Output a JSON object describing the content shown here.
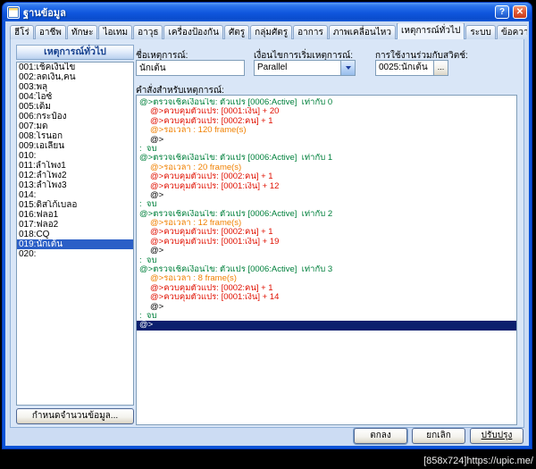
{
  "window": {
    "title": "ฐานข้อมูล",
    "controls": {
      "help": "?",
      "close": "✕"
    }
  },
  "tabs": [
    {
      "label": "ฮีโร่",
      "selected": false
    },
    {
      "label": "อาชีพ",
      "selected": false
    },
    {
      "label": "ทักษะ",
      "selected": false
    },
    {
      "label": "ไอเทม",
      "selected": false
    },
    {
      "label": "อาวุธ",
      "selected": false
    },
    {
      "label": "เครื่องป้องกัน",
      "selected": false
    },
    {
      "label": "ศัตรู",
      "selected": false
    },
    {
      "label": "กลุ่มศัตรู",
      "selected": false
    },
    {
      "label": "อาการ",
      "selected": false
    },
    {
      "label": "ภาพเคลื่อนไหว",
      "selected": false
    },
    {
      "label": "เหตุการณ์ทั่วไป",
      "selected": true
    },
    {
      "label": "ระบบ",
      "selected": false
    },
    {
      "label": "ข้อความ",
      "selected": false
    }
  ],
  "left_panel": {
    "header": "เหตุการณ์ทั่วไป",
    "items": [
      {
        "label": "001:เช็คเงินไข",
        "selected": false
      },
      {
        "label": "002:ลดเงิน,คน",
        "selected": false
      },
      {
        "label": "003:พลุ",
        "selected": false
      },
      {
        "label": "004:ไอซ์",
        "selected": false
      },
      {
        "label": "005:เด็ม",
        "selected": false
      },
      {
        "label": "006:กระป๋อง",
        "selected": false
      },
      {
        "label": "007:มด",
        "selected": false
      },
      {
        "label": "008:โรนอก",
        "selected": false
      },
      {
        "label": "009:เอเลี่ยน",
        "selected": false
      },
      {
        "label": "010:",
        "selected": false
      },
      {
        "label": "011:ลำโพง1",
        "selected": false
      },
      {
        "label": "012:ลำโพง2",
        "selected": false
      },
      {
        "label": "013:ลำโพง3",
        "selected": false
      },
      {
        "label": "014:",
        "selected": false
      },
      {
        "label": "015:ดิสโก้เบลอ",
        "selected": false
      },
      {
        "label": "016:ฟลอ1",
        "selected": false
      },
      {
        "label": "017:ฟลอ2",
        "selected": false
      },
      {
        "label": "018:CQ",
        "selected": false
      },
      {
        "label": "019:นักเต้น",
        "selected": true
      },
      {
        "label": "020:",
        "selected": false
      }
    ],
    "set_amount_button": "กำหนดจำนวนข้อมูล..."
  },
  "right_panel": {
    "name_label": "ชื่อเหตุการณ์:",
    "name_value": "นักเต้น",
    "trigger_label": "เงื่อนไขการเริ่มเหตุการณ์:",
    "trigger_value": "Parallel",
    "switch_label": "การใช้งานร่วมกับสวิตช์:",
    "switch_value": "0025:นักเต้น",
    "switch_browse": "...",
    "commands_label": "คำสั่งสำหรับเหตุการณ์:",
    "commands": [
      {
        "text": "@>ตรวจเช็คเงื่อนไข: ตัวแปร [0006:Active]  เท่ากับ 0",
        "color": "#00803c",
        "indent": 0
      },
      {
        "text": "@>ควบคุมตัวแปร: [0001:เงิน] + 20",
        "color": "#e01000",
        "indent": 1
      },
      {
        "text": "@>ควบคุมตัวแปร: [0002:คน] + 1",
        "color": "#e01000",
        "indent": 1
      },
      {
        "text": "@>รอเวลา : 120 frame(s)",
        "color": "#f08000",
        "indent": 1
      },
      {
        "text": "@>",
        "color": "#000000",
        "indent": 1
      },
      {
        "text": ":  จบ",
        "color": "#00803c",
        "indent": 0
      },
      {
        "text": "@>ตรวจเช็คเงื่อนไข: ตัวแปร [0006:Active]  เท่ากับ 1",
        "color": "#00803c",
        "indent": 0
      },
      {
        "text": "@>รอเวลา : 20 frame(s)",
        "color": "#f08000",
        "indent": 1
      },
      {
        "text": "@>ควบคุมตัวแปร: [0002:คน] + 1",
        "color": "#e01000",
        "indent": 1
      },
      {
        "text": "@>ควบคุมตัวแปร: [0001:เงิน] + 12",
        "color": "#e01000",
        "indent": 1
      },
      {
        "text": "@>",
        "color": "#000000",
        "indent": 1
      },
      {
        "text": ":  จบ",
        "color": "#00803c",
        "indent": 0
      },
      {
        "text": "@>ตรวจเช็คเงื่อนไข: ตัวแปร [0006:Active]  เท่ากับ 2",
        "color": "#00803c",
        "indent": 0
      },
      {
        "text": "@>รอเวลา : 12 frame(s)",
        "color": "#f08000",
        "indent": 1
      },
      {
        "text": "@>ควบคุมตัวแปร: [0002:คน] + 1",
        "color": "#e01000",
        "indent": 1
      },
      {
        "text": "@>ควบคุมตัวแปร: [0001:เงิน] + 19",
        "color": "#e01000",
        "indent": 1
      },
      {
        "text": "@>",
        "color": "#000000",
        "indent": 1
      },
      {
        "text": ":  จบ",
        "color": "#00803c",
        "indent": 0
      },
      {
        "text": "@>ตรวจเช็คเงื่อนไข: ตัวแปร [0006:Active]  เท่ากับ 3",
        "color": "#00803c",
        "indent": 0
      },
      {
        "text": "@>รอเวลา : 8 frame(s)",
        "color": "#f08000",
        "indent": 1
      },
      {
        "text": "@>ควบคุมตัวแปร: [0002:คน] + 1",
        "color": "#e01000",
        "indent": 1
      },
      {
        "text": "@>ควบคุมตัวแปร: [0001:เงิน] + 14",
        "color": "#e01000",
        "indent": 1
      },
      {
        "text": "@>",
        "color": "#000000",
        "indent": 1
      },
      {
        "text": ":  จบ",
        "color": "#00803c",
        "indent": 0
      },
      {
        "text": "@>",
        "color": "#000000",
        "indent": 0,
        "selected": true
      }
    ]
  },
  "footer": {
    "ok": "ตกลง",
    "cancel": "ยกเลิก",
    "apply": "ปรับปรุง"
  },
  "watermark": "[858x724]https://upic.me/",
  "colors": {
    "titlebar": "#0f56dd",
    "client_bg": "#ccdcf3",
    "selection": "#2b5fc7",
    "command_selection": "#0b1f6e",
    "condition_text": "#00803c",
    "variable_text": "#e01000",
    "wait_text": "#f08000",
    "tab_accent": "#e6902e"
  }
}
